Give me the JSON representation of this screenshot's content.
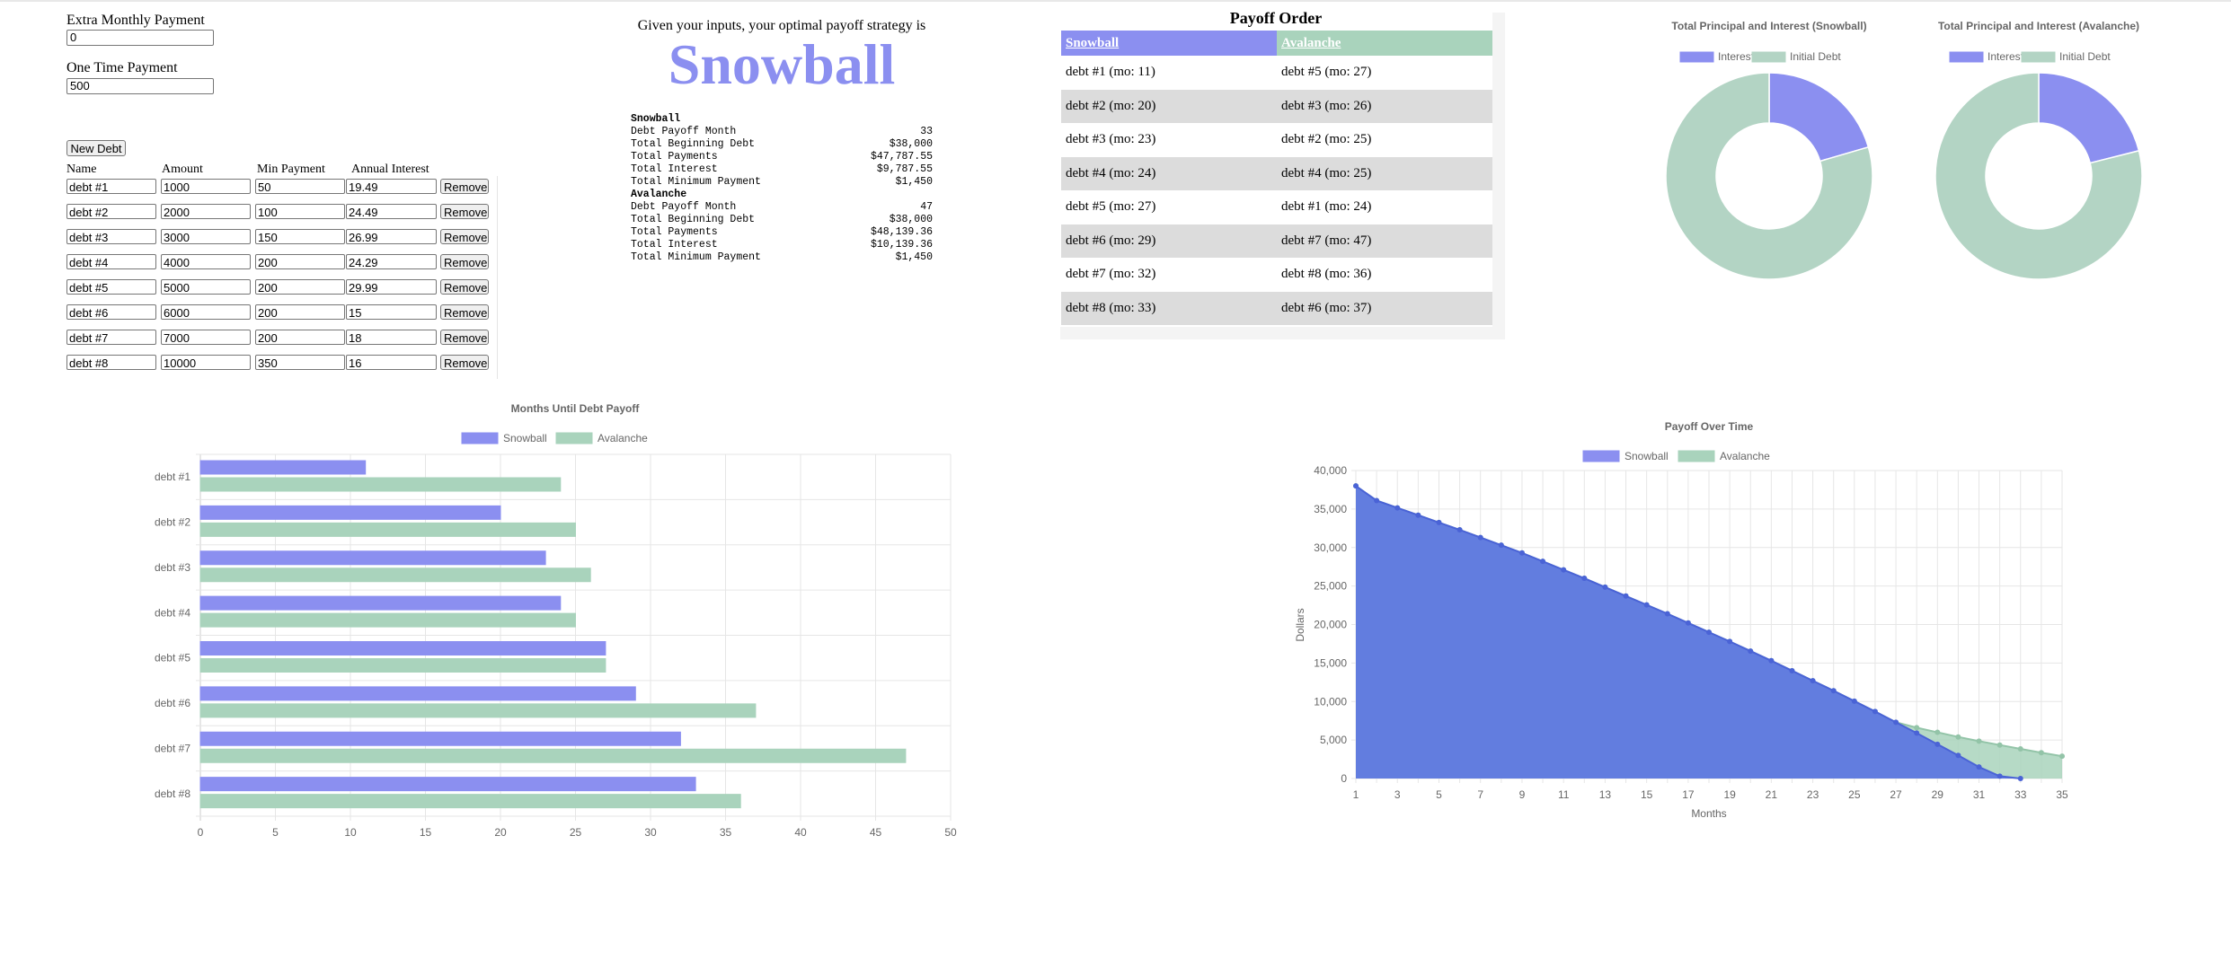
{
  "form": {
    "extra_label": "Extra Monthly Payment",
    "extra_value": "0",
    "onetime_label": "One Time Payment",
    "onetime_value": "500",
    "new_debt_label": "New Debt",
    "col_name": "Name",
    "col_amount": "Amount",
    "col_min": "Min Payment",
    "col_interest": "Annual Interest",
    "remove_label": "Remove",
    "debts": [
      {
        "name": "debt #1",
        "amount": "1000",
        "min": "50",
        "interest": "19.49"
      },
      {
        "name": "debt #2",
        "amount": "2000",
        "min": "100",
        "interest": "24.49"
      },
      {
        "name": "debt #3",
        "amount": "3000",
        "min": "150",
        "interest": "26.99"
      },
      {
        "name": "debt #4",
        "amount": "4000",
        "min": "200",
        "interest": "24.29"
      },
      {
        "name": "debt #5",
        "amount": "5000",
        "min": "200",
        "interest": "29.99"
      },
      {
        "name": "debt #6",
        "amount": "6000",
        "min": "200",
        "interest": "15"
      },
      {
        "name": "debt #7",
        "amount": "7000",
        "min": "200",
        "interest": "18"
      },
      {
        "name": "debt #8",
        "amount": "10000",
        "min": "350",
        "interest": "16"
      }
    ]
  },
  "result": {
    "intro": "Given your inputs, your optimal payoff strategy is",
    "strategy": "Snowball",
    "strategy_color": "#8b8ff0"
  },
  "summary": {
    "snowball": {
      "heading": "Snowball",
      "rows": [
        {
          "k": "Debt Payoff Month",
          "v": "33"
        },
        {
          "k": "Total Beginning Debt",
          "v": "$38,000"
        },
        {
          "k": "Total Payments",
          "v": "$47,787.55"
        },
        {
          "k": "Total Interest",
          "v": "$9,787.55"
        },
        {
          "k": "Total Minimum Payment",
          "v": "$1,450"
        }
      ]
    },
    "avalanche": {
      "heading": "Avalanche",
      "rows": [
        {
          "k": "Debt Payoff Month",
          "v": "47"
        },
        {
          "k": "Total Beginning Debt",
          "v": "$38,000"
        },
        {
          "k": "Total Payments",
          "v": "$48,139.36"
        },
        {
          "k": "Total Interest",
          "v": "$10,139.36"
        },
        {
          "k": "Total Minimum Payment",
          "v": "$1,450"
        }
      ]
    }
  },
  "payoff_order": {
    "title": "Payoff Order",
    "snowball_header": "Snowball",
    "avalanche_header": "Avalanche",
    "snowball_color": "#8b8ff0",
    "avalanche_color": "#a9d3bc",
    "rows": [
      {
        "snowball": "debt #1 (mo: 11)",
        "avalanche": "debt #5 (mo: 27)"
      },
      {
        "snowball": "debt #2 (mo: 20)",
        "avalanche": "debt #3 (mo: 26)"
      },
      {
        "snowball": "debt #3 (mo: 23)",
        "avalanche": "debt #2 (mo: 25)"
      },
      {
        "snowball": "debt #4 (mo: 24)",
        "avalanche": "debt #4 (mo: 25)"
      },
      {
        "snowball": "debt #5 (mo: 27)",
        "avalanche": "debt #1 (mo: 24)"
      },
      {
        "snowball": "debt #6 (mo: 29)",
        "avalanche": "debt #7 (mo: 47)"
      },
      {
        "snowball": "debt #7 (mo: 32)",
        "avalanche": "debt #8 (mo: 36)"
      },
      {
        "snowball": "debt #8 (mo: 33)",
        "avalanche": "debt #6 (mo: 37)"
      }
    ]
  },
  "chart_data": [
    {
      "type": "pie",
      "title": "Total Principal and Interest (Snowball)",
      "labels": [
        "Interest",
        "Initial Debt"
      ],
      "values": [
        9787.55,
        38000
      ],
      "colors": [
        "#8b8ff0",
        "#b3d4c4"
      ],
      "legend": "top"
    },
    {
      "type": "pie",
      "title": "Total Principal and Interest (Avalanche)",
      "labels": [
        "Interest",
        "Initial Debt"
      ],
      "values": [
        10139.36,
        38000
      ],
      "colors": [
        "#8b8ff0",
        "#b3d4c4"
      ],
      "legend": "top"
    },
    {
      "type": "bar",
      "orientation": "horizontal",
      "title": "Months Until Debt Payoff",
      "categories": [
        "debt #1",
        "debt #2",
        "debt #3",
        "debt #4",
        "debt #5",
        "debt #6",
        "debt #7",
        "debt #8"
      ],
      "series": [
        {
          "name": "Snowball",
          "values": [
            11,
            20,
            23,
            24,
            27,
            29,
            32,
            33
          ],
          "color": "#8b8ff0"
        },
        {
          "name": "Avalanche",
          "values": [
            24,
            25,
            26,
            25,
            27,
            37,
            47,
            36
          ],
          "color": "#a9d3bc"
        }
      ],
      "xlim": [
        0,
        50
      ],
      "xticks": [
        0,
        5,
        10,
        15,
        20,
        25,
        30,
        35,
        40,
        45,
        50
      ],
      "grid": true,
      "legend": "top"
    },
    {
      "type": "area",
      "title": "Payoff Over Time",
      "xlabel": "Months",
      "ylabel": "Dollars",
      "x": [
        1,
        2,
        3,
        4,
        5,
        6,
        7,
        8,
        9,
        10,
        11,
        12,
        13,
        14,
        15,
        16,
        17,
        18,
        19,
        20,
        21,
        22,
        23,
        24,
        25,
        26,
        27,
        28,
        29,
        30,
        31,
        32,
        33,
        34,
        35
      ],
      "series": [
        {
          "name": "Snowball",
          "color": "#5e78e0",
          "values": [
            38000,
            36100,
            35150,
            34200,
            33250,
            32300,
            31300,
            30300,
            29300,
            28200,
            27100,
            26000,
            24850,
            23700,
            22550,
            21400,
            20200,
            19000,
            17800,
            16550,
            15300,
            14000,
            12700,
            11400,
            10050,
            8700,
            7300,
            5900,
            4450,
            3000,
            1500,
            300,
            0
          ]
        },
        {
          "name": "Avalanche",
          "color": "#a9d3bc",
          "values": [
            38000,
            36100,
            35150,
            34200,
            33250,
            32300,
            31300,
            30300,
            29300,
            28200,
            27100,
            26000,
            24850,
            23700,
            22550,
            21400,
            20200,
            19000,
            17800,
            16550,
            15300,
            14000,
            12700,
            11400,
            10050,
            8700,
            7300,
            6600,
            6000,
            5400,
            4850,
            4350,
            3850,
            3350,
            2900
          ]
        }
      ],
      "ylim": [
        0,
        40000
      ],
      "yticks": [
        "0",
        "5,000",
        "10,000",
        "15,000",
        "20,000",
        "25,000",
        "30,000",
        "35,000",
        "40,000"
      ],
      "grid": true,
      "legend": "top"
    }
  ]
}
